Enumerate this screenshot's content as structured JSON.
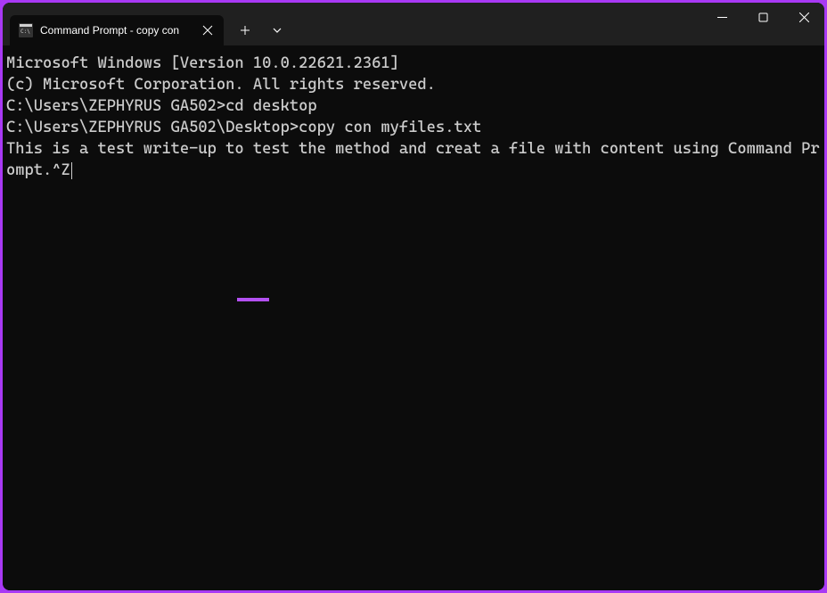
{
  "titlebar": {
    "tab": {
      "title": "Command Prompt - copy  con"
    }
  },
  "terminal": {
    "line1": "Microsoft Windows [Version 10.0.22621.2361]",
    "line2": "(c) Microsoft Corporation. All rights reserved.",
    "blank1": "",
    "prompt1_path": "C:\\Users\\ZEPHYRUS GA502>",
    "prompt1_cmd": "cd desktop",
    "blank2": "",
    "prompt2_path": "C:\\Users\\ZEPHYRUS GA502\\Desktop>",
    "prompt2_cmd": "copy con myfiles.txt",
    "blank3": "",
    "content_line": "This is a test write-up to test the method and creat a file with content using Command Prompt.^Z"
  },
  "colors": {
    "accent": "#a939f5",
    "terminal_bg": "#0c0c0c",
    "titlebar_bg": "#202020",
    "text": "#cccccc"
  }
}
